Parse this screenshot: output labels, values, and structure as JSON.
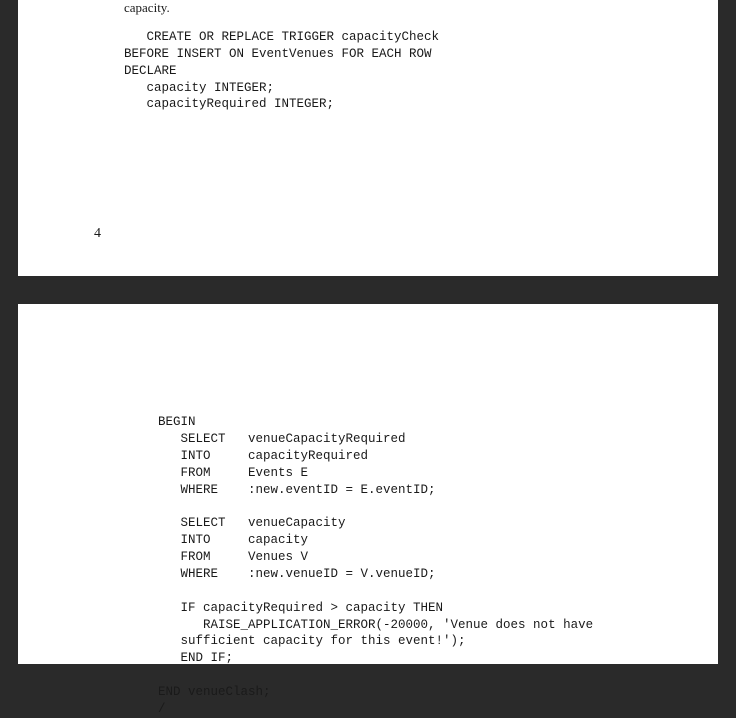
{
  "page1": {
    "intro": "capacity.",
    "code": "   CREATE OR REPLACE TRIGGER capacityCheck\nBEFORE INSERT ON EventVenues FOR EACH ROW\nDECLARE\n   capacity INTEGER;\n   capacityRequired INTEGER;",
    "pageNumber": "4"
  },
  "page2": {
    "code": "BEGIN\n   SELECT   venueCapacityRequired\n   INTO     capacityRequired\n   FROM     Events E\n   WHERE    :new.eventID = E.eventID;\n\n   SELECT   venueCapacity\n   INTO     capacity\n   FROM     Venues V\n   WHERE    :new.venueID = V.venueID;\n\n   IF capacityRequired > capacity THEN\n      RAISE_APPLICATION_ERROR(-20000, 'Venue does not have\n   sufficient capacity for this event!');\n   END IF;\n\nEND venueClash;\n/"
  }
}
